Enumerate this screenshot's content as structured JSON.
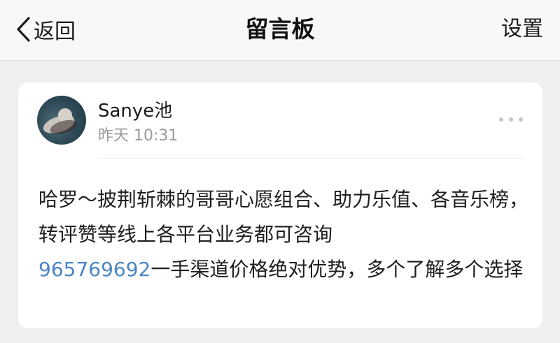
{
  "navbar": {
    "back_label": "返回",
    "title": "留言板",
    "settings_label": "设置"
  },
  "post": {
    "username": "Sanye池",
    "time": "昨天 10:31",
    "content_before": "哈罗～披荆斩棘的哥哥心愿组合、助力乐值、各音乐榜，转评赞等线上各平台业务都可咨询",
    "phone": "965769692",
    "content_after": "一手渠道价格绝对优势，多个了解多个选择"
  },
  "colors": {
    "link": "#4a86c5",
    "background": "#efeff1",
    "card": "#ffffff"
  },
  "icons": {
    "back": "chevron-left-icon",
    "more": "more-dots-icon"
  }
}
